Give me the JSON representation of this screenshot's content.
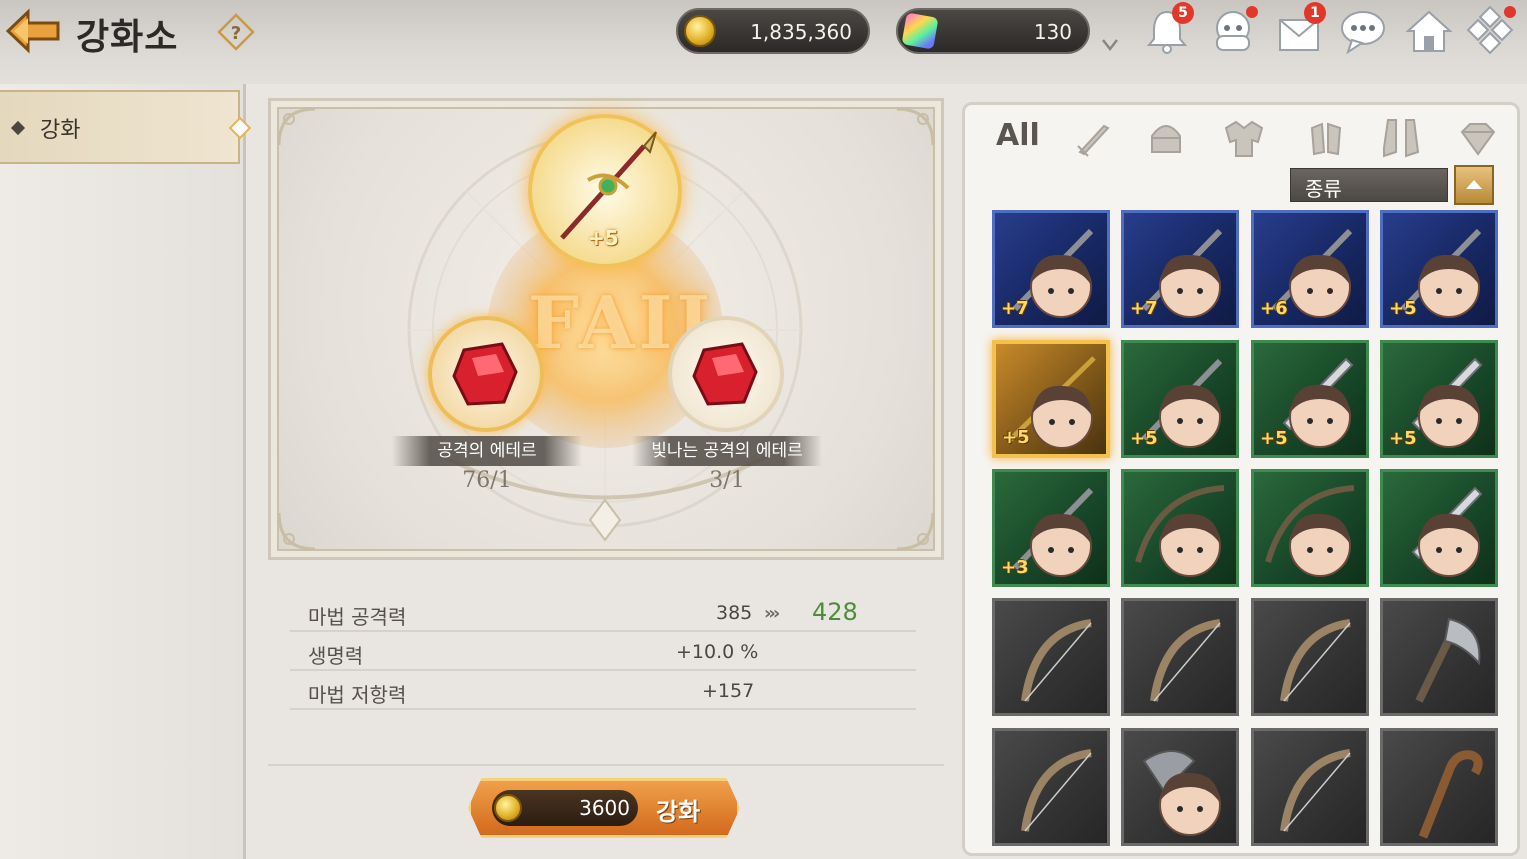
{
  "header": {
    "title": "강화소",
    "gold": "1,835,360",
    "crystal": "130",
    "notification_badge": "5",
    "mail_badge": "1"
  },
  "sidebar": {
    "items": [
      {
        "label": "강화"
      }
    ]
  },
  "forge": {
    "result_text": "FAIL",
    "equipped_level": "+5",
    "materials": [
      {
        "name": "공격의 에테르",
        "count": "76/1"
      },
      {
        "name": "빛나는 공격의 에테르",
        "count": "3/1"
      }
    ]
  },
  "stats": [
    {
      "name": "마법 공격력",
      "current": "385",
      "next": "428"
    },
    {
      "name": "생명력",
      "current": "+10.0 %"
    },
    {
      "name": "마법 저항력",
      "current": "+157"
    }
  ],
  "enhance_button": {
    "cost": "3600",
    "label": "강화"
  },
  "inventory": {
    "tab_all_label": "All",
    "filter_tabs": [
      "weapon-sword-icon",
      "helmet-icon",
      "armor-icon",
      "gloves-icon",
      "boots-icon",
      "gem-icon"
    ],
    "sort_label": "종류",
    "items": [
      {
        "level": "+7",
        "rarity": "blue",
        "icon": "hero-portrait"
      },
      {
        "level": "+7",
        "rarity": "blue",
        "icon": "hero-portrait"
      },
      {
        "level": "+6",
        "rarity": "blue",
        "icon": "hero-portrait"
      },
      {
        "level": "+5",
        "rarity": "blue",
        "icon": "hero-portrait"
      },
      {
        "level": "+5",
        "rarity": "gold-selected",
        "icon": "spear-hero-portrait"
      },
      {
        "level": "+5",
        "rarity": "green",
        "icon": "hero-portrait"
      },
      {
        "level": "+5",
        "rarity": "green",
        "icon": "sword-hero-portrait"
      },
      {
        "level": "+5",
        "rarity": "green",
        "icon": "sword-hero-portrait"
      },
      {
        "level": "+3",
        "rarity": "green",
        "icon": "hero-portrait"
      },
      {
        "level": "",
        "rarity": "green",
        "icon": "bow-hero-portrait"
      },
      {
        "level": "",
        "rarity": "green",
        "icon": "crossbow-hero-portrait"
      },
      {
        "level": "",
        "rarity": "green",
        "icon": "sword-hero-portrait"
      },
      {
        "level": "",
        "rarity": "gray",
        "icon": "bow-icon"
      },
      {
        "level": "",
        "rarity": "gray",
        "icon": "bow-icon"
      },
      {
        "level": "",
        "rarity": "gray",
        "icon": "bow-icon"
      },
      {
        "level": "",
        "rarity": "gray",
        "icon": "axe-icon"
      },
      {
        "level": "",
        "rarity": "gray",
        "icon": "bow-icon"
      },
      {
        "level": "",
        "rarity": "gray",
        "icon": "axe-hero-portrait"
      },
      {
        "level": "",
        "rarity": "gray",
        "icon": "bow-icon"
      },
      {
        "level": "",
        "rarity": "gray",
        "icon": "staff-icon"
      }
    ]
  }
}
